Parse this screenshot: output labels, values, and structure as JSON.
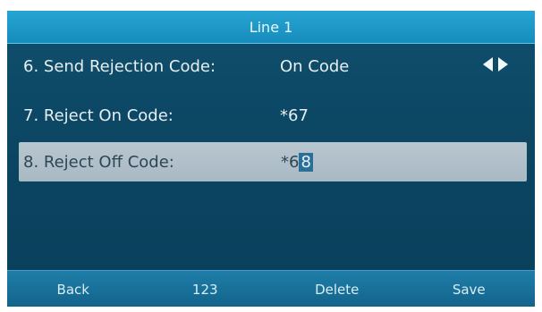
{
  "title": "Line 1",
  "rows": [
    {
      "label": "6. Send Rejection Code:",
      "value": "On Code"
    },
    {
      "label": "7. Reject On Code:",
      "value": "*67"
    },
    {
      "label": "8. Reject Off Code:",
      "value_prefix": "*6",
      "value_cursor": "8"
    }
  ],
  "softkeys": [
    "Back",
    "123",
    "Delete",
    "Save"
  ]
}
